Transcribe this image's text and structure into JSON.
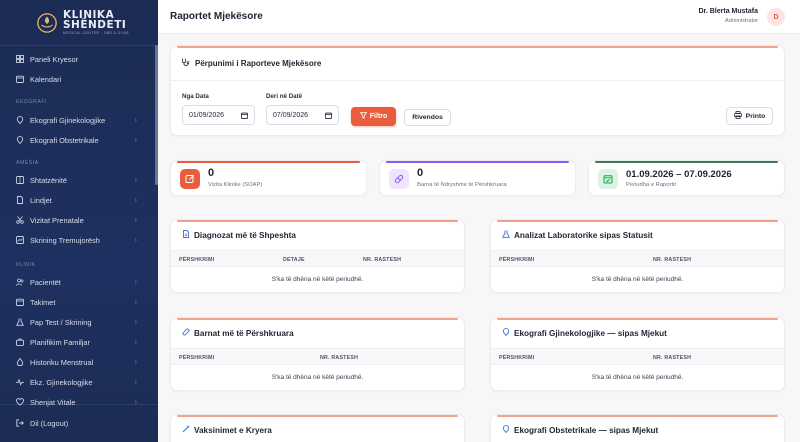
{
  "brand": {
    "line1": "KLINIKA",
    "line2": "SHËNDETI",
    "tagline": "MEDICAL CENTER · OBS & GYNE"
  },
  "sidebar": {
    "top_items": [
      {
        "label": "Paneli Kryesor",
        "icon": "dashboard-icon"
      },
      {
        "label": "Kalendari",
        "icon": "calendar-icon"
      }
    ],
    "section_ekografi": "EKOGRAFI",
    "ekografi_items": [
      {
        "label": "Ekografi Gjinekologjike",
        "icon": "location-pin-icon"
      },
      {
        "label": "Ekografi Obstetrikale",
        "icon": "location-pin-icon"
      }
    ],
    "section_amesia": "AMËSIA",
    "amesia_items": [
      {
        "label": "Shtatzënitë",
        "icon": "grid-icon"
      },
      {
        "label": "Lindjet",
        "icon": "file-icon"
      },
      {
        "label": "Vizitat Prenatale",
        "icon": "scissors-icon"
      },
      {
        "label": "Skrining Tremujorësh",
        "icon": "chart-icon"
      }
    ],
    "section_klinik": "KLINIK",
    "klinik_items": [
      {
        "label": "Pacientët",
        "icon": "users-icon"
      },
      {
        "label": "Takimet",
        "icon": "calendar-icon"
      },
      {
        "label": "Pap Test / Skrining",
        "icon": "flask-icon"
      },
      {
        "label": "Planifikim Familjar",
        "icon": "briefcase-icon"
      },
      {
        "label": "Historiku Menstrual",
        "icon": "droplet-icon"
      },
      {
        "label": "Ekz. Gjinekologjike",
        "icon": "pulse-icon"
      },
      {
        "label": "Shenjat Vitale",
        "icon": "heart-icon"
      }
    ],
    "logout": "Dil (Logout)"
  },
  "header": {
    "title": "Raportet Mjekësore",
    "user_name": "Dr. Blerta Mustafa",
    "user_role": "Administrator",
    "avatar_initial": "D"
  },
  "filter": {
    "title": "Përpunimi i Raporteve Mjekësore",
    "from_label": "Nga Data",
    "from_value": "01/09/2026",
    "to_label": "Deri në Datë",
    "to_value": "07/09/2026",
    "filter_btn": "Filtro",
    "reset_btn": "Rivendos",
    "print_btn": "Printo"
  },
  "stats": [
    {
      "value": "0",
      "label": "Vizita Klinike (SOAP)",
      "accent": "#ea5c3e"
    },
    {
      "value": "0",
      "label": "Barna të Ndryshme të Përshkruara",
      "accent": "#8b5cf6"
    },
    {
      "value": "01.09.2026 – 07.09.2026",
      "label": "Periudha e Raportit",
      "accent": "#16a34a"
    }
  ],
  "tables": [
    {
      "title": "Diagnozat më të Shpeshta",
      "icon": "document-icon",
      "cols": [
        "PËRSHKRIMI",
        "DETAJE",
        "NR. RASTESH"
      ],
      "empty": "S'ka të dhëna në këtë periudhë."
    },
    {
      "title": "Analizat Laboratorike sipas Statusit",
      "icon": "flask-icon",
      "cols": [
        "PËRSHKRIMI",
        "NR. RASTESH"
      ],
      "empty": "S'ka të dhëna në këtë periudhë."
    },
    {
      "title": "Barnat më të Përshkruara",
      "icon": "pill-icon",
      "cols": [
        "PËRSHKRIMI",
        "NR. RASTESH"
      ],
      "empty": "S'ka të dhëna në këtë periudhë."
    },
    {
      "title": "Ekografi Gjinekologjike — sipas Mjekut",
      "icon": "location-pin-icon",
      "cols": [
        "PËRSHKRIMI",
        "NR. RASTESH"
      ],
      "empty": "S'ka të dhëna në këtë periudhë."
    },
    {
      "title": "Vaksinimet e Kryera",
      "icon": "syringe-icon"
    },
    {
      "title": "Ekografi Obstetrikale — sipas Mjekut",
      "icon": "location-pin-icon"
    }
  ]
}
